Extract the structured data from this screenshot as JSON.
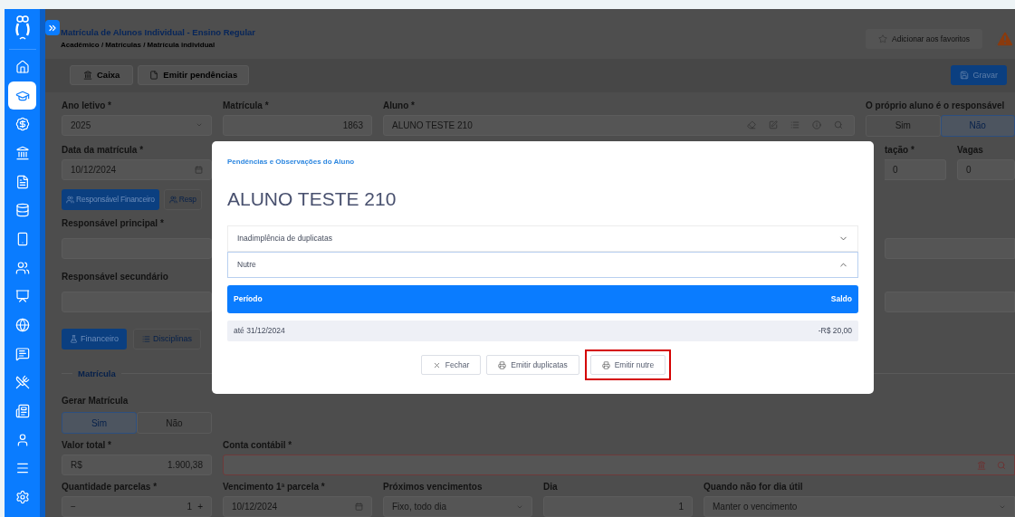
{
  "sidebar": {
    "items": [
      {
        "selected": false
      },
      {
        "selected": true
      },
      {
        "selected": false
      },
      {
        "selected": false
      },
      {
        "selected": false
      },
      {
        "selected": false
      },
      {
        "selected": false
      },
      {
        "selected": false
      },
      {
        "selected": false
      },
      {
        "selected": false
      },
      {
        "selected": false
      },
      {
        "selected": false
      },
      {
        "selected": false
      },
      {
        "selected": false
      },
      {
        "selected": false
      },
      {
        "selected": false
      }
    ]
  },
  "header": {
    "title": "Matrícula de Alunos Individual - Ensino Regular",
    "breadcrumb": "Acadêmico / Matrículas / Matrícula individual",
    "favorite_button": "Adicionar aos favoritos"
  },
  "toolbar": {
    "buttons": [
      "Caixa",
      "Emitir pendências"
    ],
    "save_button": "Gravar"
  },
  "form": {
    "ano_letivo": {
      "label": "Ano letivo *",
      "value": "2025"
    },
    "matricula": {
      "label": "Matrícula *",
      "value": "1863"
    },
    "aluno": {
      "label": "Aluno *",
      "value": "ALUNO TESTE 210"
    },
    "proprio_responsavel": {
      "label": "O próprio aluno é o responsável",
      "options": [
        {
          "label": "Sim",
          "selected": false
        },
        {
          "label": "Não",
          "selected": true
        }
      ]
    },
    "data_matricula": {
      "label": "Data da matrícula *",
      "value": "10/12/2024"
    },
    "lotacao": {
      "label": "tação *",
      "value": "0"
    },
    "vagas": {
      "label": "Vagas",
      "value": "0"
    },
    "responsavel_buttons": [
      {
        "label": "Responsável Financeiro",
        "selected": true
      },
      {
        "label": "Resp",
        "selected": false
      }
    ],
    "responsavel_principal": {
      "label": "Responsável principal *"
    },
    "responsavel_secundario": {
      "label": "Responsável secundário"
    },
    "tabs": [
      {
        "label": "Financeiro",
        "selected": true
      },
      {
        "label": "Disciplinas",
        "selected": false
      }
    ],
    "section": "Matrícula",
    "gerar_matricula": {
      "label": "Gerar Matrícula",
      "options": [
        {
          "label": "Sim",
          "selected": true
        },
        {
          "label": "Não",
          "selected": false
        }
      ]
    },
    "valor_total": {
      "label": "Valor total *",
      "prefix": "R$",
      "value": "1.900,38"
    },
    "conta_contabil": {
      "label": "Conta contábil *",
      "invalid": true
    },
    "quantidade_parcelas": {
      "label": "Quantidade parcelas *",
      "decrement": "−",
      "value": "1",
      "increment": "+"
    },
    "vencimento": {
      "label": "Vencimento 1ª parcela *",
      "value": "10/12/2024"
    },
    "proximos_vencimentos": {
      "label": "Próximos vencimentos",
      "value": "Fixo, todo dia"
    },
    "dia": {
      "label": "Dia",
      "value": "1"
    },
    "dia_util": {
      "label": "Quando não for dia útil",
      "value": "Manter o vencimento"
    }
  },
  "modal": {
    "title": "Pendências e Observações do Aluno",
    "student": "ALUNO TESTE 210",
    "sections": [
      {
        "title": "Inadimplência de duplicatas",
        "expanded": false
      },
      {
        "title": "Nutre",
        "expanded": true,
        "table": {
          "columns": [
            "Período",
            "Saldo"
          ],
          "rows": [
            [
              "até 31/12/2024",
              "-R$ 20,00"
            ]
          ]
        }
      }
    ],
    "buttons": [
      {
        "label": "Fechar",
        "kind": "close",
        "highlighted": false
      },
      {
        "label": "Emitir duplicatas",
        "kind": "print",
        "highlighted": false
      },
      {
        "label": "Emitir nutre",
        "kind": "print",
        "highlighted": true
      }
    ]
  }
}
